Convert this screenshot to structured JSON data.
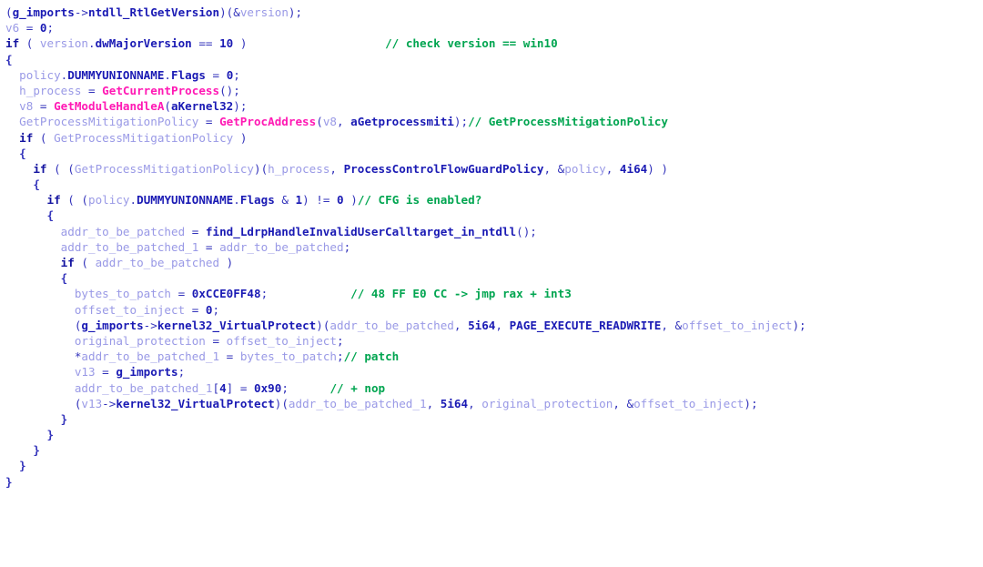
{
  "view": {
    "name": "hex-rays-pseudocode",
    "background": "#ffffff",
    "default_text_color": "#3333bb"
  },
  "colors": {
    "plain": "#3333bb",
    "keyword": "#1414a0",
    "local_variable": "#9999e6",
    "number": "#1a1ab4",
    "local_function": "#1a1ab4",
    "winapi_function": "#ff19b4",
    "global_or_member": "#1a1ab4",
    "constant": "#1a1ab4",
    "string_ref": "#1a1ab4",
    "comment": "#00a550"
  },
  "code": {
    "lines": [
      {
        "indent": 0,
        "tokens": [
          {
            "t": "(",
            "c": "plain"
          },
          {
            "t": "g_imports",
            "c": "global_or_member"
          },
          {
            "t": "->",
            "c": "plain"
          },
          {
            "t": "ntdll_RtlGetVersion",
            "c": "global_or_member"
          },
          {
            "t": ")(&",
            "c": "plain"
          },
          {
            "t": "version",
            "c": "local_variable"
          },
          {
            "t": ");",
            "c": "plain"
          }
        ]
      },
      {
        "indent": 0,
        "tokens": [
          {
            "t": "v6",
            "c": "local_variable"
          },
          {
            "t": " = ",
            "c": "plain"
          },
          {
            "t": "0",
            "c": "number"
          },
          {
            "t": ";",
            "c": "plain"
          }
        ]
      },
      {
        "indent": 0,
        "tokens": [
          {
            "t": "if",
            "c": "keyword"
          },
          {
            "t": " ( ",
            "c": "plain"
          },
          {
            "t": "version",
            "c": "local_variable"
          },
          {
            "t": ".",
            "c": "plain"
          },
          {
            "t": "dwMajorVersion",
            "c": "global_or_member"
          },
          {
            "t": " == ",
            "c": "plain"
          },
          {
            "t": "10",
            "c": "number"
          },
          {
            "t": " )",
            "c": "plain"
          },
          {
            "t": "                    ",
            "c": "plain"
          },
          {
            "t": "// check version == win10",
            "c": "comment"
          }
        ]
      },
      {
        "indent": 0,
        "tokens": [
          {
            "t": "{",
            "c": "brace"
          }
        ]
      },
      {
        "indent": 1,
        "tokens": [
          {
            "t": "policy",
            "c": "local_variable"
          },
          {
            "t": ".",
            "c": "plain"
          },
          {
            "t": "DUMMYUNIONNAME",
            "c": "global_or_member"
          },
          {
            "t": ".",
            "c": "plain"
          },
          {
            "t": "Flags",
            "c": "global_or_member"
          },
          {
            "t": " = ",
            "c": "plain"
          },
          {
            "t": "0",
            "c": "number"
          },
          {
            "t": ";",
            "c": "plain"
          }
        ]
      },
      {
        "indent": 1,
        "tokens": [
          {
            "t": "h_process",
            "c": "local_variable"
          },
          {
            "t": " = ",
            "c": "plain"
          },
          {
            "t": "GetCurrentProcess",
            "c": "winapi_function"
          },
          {
            "t": "();",
            "c": "plain"
          }
        ]
      },
      {
        "indent": 1,
        "tokens": [
          {
            "t": "v8",
            "c": "local_variable"
          },
          {
            "t": " = ",
            "c": "plain"
          },
          {
            "t": "GetModuleHandleA",
            "c": "winapi_function"
          },
          {
            "t": "(",
            "c": "plain"
          },
          {
            "t": "aKernel32",
            "c": "string_ref"
          },
          {
            "t": ");",
            "c": "plain"
          }
        ]
      },
      {
        "indent": 1,
        "tokens": [
          {
            "t": "GetProcessMitigationPolicy",
            "c": "local_variable"
          },
          {
            "t": " = ",
            "c": "plain"
          },
          {
            "t": "GetProcAddress",
            "c": "winapi_function"
          },
          {
            "t": "(",
            "c": "plain"
          },
          {
            "t": "v8",
            "c": "local_variable"
          },
          {
            "t": ", ",
            "c": "plain"
          },
          {
            "t": "aGetprocessmiti",
            "c": "string_ref"
          },
          {
            "t": ");",
            "c": "plain"
          },
          {
            "t": "// GetProcessMitigationPolicy",
            "c": "comment"
          }
        ]
      },
      {
        "indent": 1,
        "tokens": [
          {
            "t": "if",
            "c": "keyword"
          },
          {
            "t": " ( ",
            "c": "plain"
          },
          {
            "t": "GetProcessMitigationPolicy",
            "c": "local_variable"
          },
          {
            "t": " )",
            "c": "plain"
          }
        ]
      },
      {
        "indent": 1,
        "tokens": [
          {
            "t": "{",
            "c": "brace"
          }
        ]
      },
      {
        "indent": 2,
        "tokens": [
          {
            "t": "if",
            "c": "keyword"
          },
          {
            "t": " ( (",
            "c": "plain"
          },
          {
            "t": "GetProcessMitigationPolicy",
            "c": "local_variable"
          },
          {
            "t": ")(",
            "c": "plain"
          },
          {
            "t": "h_process",
            "c": "local_variable"
          },
          {
            "t": ", ",
            "c": "plain"
          },
          {
            "t": "ProcessControlFlowGuardPolicy",
            "c": "constant"
          },
          {
            "t": ", &",
            "c": "plain"
          },
          {
            "t": "policy",
            "c": "local_variable"
          },
          {
            "t": ", ",
            "c": "plain"
          },
          {
            "t": "4i64",
            "c": "number"
          },
          {
            "t": ") )",
            "c": "plain"
          }
        ]
      },
      {
        "indent": 2,
        "tokens": [
          {
            "t": "{",
            "c": "brace"
          }
        ]
      },
      {
        "indent": 3,
        "tokens": [
          {
            "t": "if",
            "c": "keyword"
          },
          {
            "t": " ( (",
            "c": "plain"
          },
          {
            "t": "policy",
            "c": "local_variable"
          },
          {
            "t": ".",
            "c": "plain"
          },
          {
            "t": "DUMMYUNIONNAME",
            "c": "global_or_member"
          },
          {
            "t": ".",
            "c": "plain"
          },
          {
            "t": "Flags",
            "c": "global_or_member"
          },
          {
            "t": " & ",
            "c": "plain"
          },
          {
            "t": "1",
            "c": "number"
          },
          {
            "t": ") != ",
            "c": "plain"
          },
          {
            "t": "0",
            "c": "number"
          },
          {
            "t": " )",
            "c": "plain"
          },
          {
            "t": "// CFG is enabled?",
            "c": "comment"
          }
        ]
      },
      {
        "indent": 3,
        "tokens": [
          {
            "t": "{",
            "c": "brace"
          }
        ]
      },
      {
        "indent": 4,
        "tokens": [
          {
            "t": "addr_to_be_patched",
            "c": "local_variable"
          },
          {
            "t": " = ",
            "c": "plain"
          },
          {
            "t": "find_LdrpHandleInvalidUserCalltarget_in_ntdll",
            "c": "local_function"
          },
          {
            "t": "();",
            "c": "plain"
          }
        ]
      },
      {
        "indent": 4,
        "tokens": [
          {
            "t": "addr_to_be_patched_1",
            "c": "local_variable"
          },
          {
            "t": " = ",
            "c": "plain"
          },
          {
            "t": "addr_to_be_patched",
            "c": "local_variable"
          },
          {
            "t": ";",
            "c": "plain"
          }
        ]
      },
      {
        "indent": 4,
        "tokens": [
          {
            "t": "if",
            "c": "keyword"
          },
          {
            "t": " ( ",
            "c": "plain"
          },
          {
            "t": "addr_to_be_patched",
            "c": "local_variable"
          },
          {
            "t": " )",
            "c": "plain"
          }
        ]
      },
      {
        "indent": 4,
        "tokens": [
          {
            "t": "{",
            "c": "brace"
          }
        ]
      },
      {
        "indent": 5,
        "tokens": [
          {
            "t": "bytes_to_patch",
            "c": "local_variable"
          },
          {
            "t": " = ",
            "c": "plain"
          },
          {
            "t": "0xCCE0FF48",
            "c": "number"
          },
          {
            "t": ";",
            "c": "plain"
          },
          {
            "t": "            ",
            "c": "plain"
          },
          {
            "t": "// 48 FF E0 CC -> jmp rax + int3",
            "c": "comment"
          }
        ]
      },
      {
        "indent": 5,
        "tokens": [
          {
            "t": "offset_to_inject",
            "c": "local_variable"
          },
          {
            "t": " = ",
            "c": "plain"
          },
          {
            "t": "0",
            "c": "number"
          },
          {
            "t": ";",
            "c": "plain"
          }
        ]
      },
      {
        "indent": 5,
        "tokens": [
          {
            "t": "(",
            "c": "plain"
          },
          {
            "t": "g_imports",
            "c": "global_or_member"
          },
          {
            "t": "->",
            "c": "plain"
          },
          {
            "t": "kernel32_VirtualProtect",
            "c": "global_or_member"
          },
          {
            "t": ")(",
            "c": "plain"
          },
          {
            "t": "addr_to_be_patched",
            "c": "local_variable"
          },
          {
            "t": ", ",
            "c": "plain"
          },
          {
            "t": "5i64",
            "c": "number"
          },
          {
            "t": ", ",
            "c": "plain"
          },
          {
            "t": "PAGE_EXECUTE_READWRITE",
            "c": "constant"
          },
          {
            "t": ", &",
            "c": "plain"
          },
          {
            "t": "offset_to_inject",
            "c": "local_variable"
          },
          {
            "t": ");",
            "c": "plain"
          }
        ]
      },
      {
        "indent": 5,
        "tokens": [
          {
            "t": "original_protection",
            "c": "local_variable"
          },
          {
            "t": " = ",
            "c": "plain"
          },
          {
            "t": "offset_to_inject",
            "c": "local_variable"
          },
          {
            "t": ";",
            "c": "plain"
          }
        ]
      },
      {
        "indent": 5,
        "tokens": [
          {
            "t": "*",
            "c": "plain"
          },
          {
            "t": "addr_to_be_patched_1",
            "c": "local_variable"
          },
          {
            "t": " = ",
            "c": "plain"
          },
          {
            "t": "bytes_to_patch",
            "c": "local_variable"
          },
          {
            "t": ";",
            "c": "plain"
          },
          {
            "t": "// patch",
            "c": "comment"
          }
        ]
      },
      {
        "indent": 5,
        "tokens": [
          {
            "t": "v13",
            "c": "local_variable"
          },
          {
            "t": " = ",
            "c": "plain"
          },
          {
            "t": "g_imports",
            "c": "global_or_member"
          },
          {
            "t": ";",
            "c": "plain"
          }
        ]
      },
      {
        "indent": 5,
        "tokens": [
          {
            "t": "addr_to_be_patched_1",
            "c": "local_variable"
          },
          {
            "t": "[",
            "c": "plain"
          },
          {
            "t": "4",
            "c": "number"
          },
          {
            "t": "] = ",
            "c": "plain"
          },
          {
            "t": "0x90",
            "c": "number"
          },
          {
            "t": ";",
            "c": "plain"
          },
          {
            "t": "      ",
            "c": "plain"
          },
          {
            "t": "// + nop",
            "c": "comment"
          }
        ]
      },
      {
        "indent": 5,
        "tokens": [
          {
            "t": "(",
            "c": "plain"
          },
          {
            "t": "v13",
            "c": "local_variable"
          },
          {
            "t": "->",
            "c": "plain"
          },
          {
            "t": "kernel32_VirtualProtect",
            "c": "global_or_member"
          },
          {
            "t": ")(",
            "c": "plain"
          },
          {
            "t": "addr_to_be_patched_1",
            "c": "local_variable"
          },
          {
            "t": ", ",
            "c": "plain"
          },
          {
            "t": "5i64",
            "c": "number"
          },
          {
            "t": ", ",
            "c": "plain"
          },
          {
            "t": "original_protection",
            "c": "local_variable"
          },
          {
            "t": ", &",
            "c": "plain"
          },
          {
            "t": "offset_to_inject",
            "c": "local_variable"
          },
          {
            "t": ");",
            "c": "plain"
          }
        ]
      },
      {
        "indent": 4,
        "tokens": [
          {
            "t": "}",
            "c": "brace"
          }
        ]
      },
      {
        "indent": 3,
        "tokens": [
          {
            "t": "}",
            "c": "brace"
          }
        ]
      },
      {
        "indent": 2,
        "tokens": [
          {
            "t": "}",
            "c": "brace"
          }
        ]
      },
      {
        "indent": 1,
        "tokens": [
          {
            "t": "}",
            "c": "brace"
          }
        ]
      },
      {
        "indent": 0,
        "tokens": [
          {
            "t": "}",
            "c": "brace"
          }
        ]
      }
    ]
  }
}
